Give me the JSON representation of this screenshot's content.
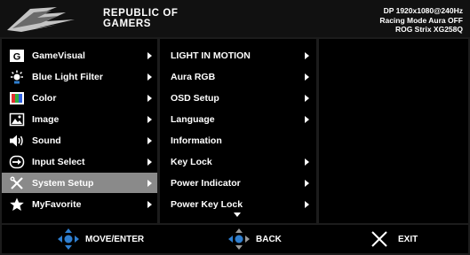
{
  "header": {
    "brand_line1": "REPUBLIC OF",
    "brand_line2": "GAMERS",
    "status_line1": "DP 1920x1080@240Hz",
    "status_line2": "Racing Mode  Aura OFF",
    "status_line3": "ROG Strix XG258Q"
  },
  "main_menu": {
    "items": [
      {
        "label": "GameVisual",
        "icon": "gamevisual-icon"
      },
      {
        "label": "Blue Light Filter",
        "icon": "blue-light-icon"
      },
      {
        "label": "Color",
        "icon": "color-icon"
      },
      {
        "label": "Image",
        "icon": "image-icon"
      },
      {
        "label": "Sound",
        "icon": "sound-icon"
      },
      {
        "label": "Input Select",
        "icon": "input-select-icon"
      },
      {
        "label": "System Setup",
        "icon": "wrench-icon"
      },
      {
        "label": "MyFavorite",
        "icon": "star-icon"
      }
    ],
    "selected": "System Setup"
  },
  "sub_menu": {
    "items": [
      {
        "label": "LIGHT IN MOTION"
      },
      {
        "label": "Aura RGB"
      },
      {
        "label": "OSD Setup"
      },
      {
        "label": "Language"
      },
      {
        "label": "Information"
      },
      {
        "label": "Key Lock"
      },
      {
        "label": "Power Indicator"
      },
      {
        "label": "Power Key Lock"
      }
    ]
  },
  "footer": {
    "move_label": "MOVE/ENTER",
    "back_label": "BACK",
    "exit_label": "EXIT"
  },
  "colors": {
    "background": "#000000",
    "selected_row": "#8a8a8a",
    "joystick_blue": "#2f7fd0"
  }
}
